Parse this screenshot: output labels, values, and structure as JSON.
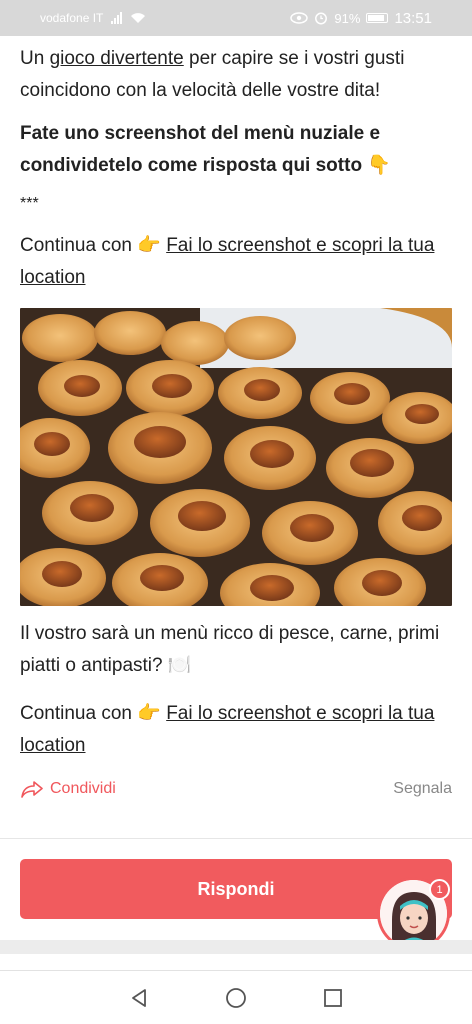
{
  "status": {
    "carrier": "vodafone IT",
    "battery": "91%",
    "time": "13:51"
  },
  "post": {
    "p1_a": "Un ",
    "p1_link": "gioco divertente",
    "p1_b": " per capire se i vostri gusti coincidono con la velocità delle vostre dita!",
    "p2": "Fate uno screenshot del menù nuziale e condividetelo come risposta qui sotto 👇",
    "stars": "***",
    "cont1_prefix": "Continua con 👉 ",
    "cont1_link": "Fai lo screenshot e scopri la tua location",
    "p3": "Il vostro sarà un menù ricco di pesce, carne, primi piatti o antipasti? 🍽️",
    "cont2_prefix": "Continua con 👉 ",
    "cont2_link": "Fai lo screenshot e scopri la tua location"
  },
  "actions": {
    "share": "Condividi",
    "report": "Segnala"
  },
  "reply": {
    "label": "Rispondi"
  },
  "notification": {
    "count": "1"
  },
  "colors": {
    "accent": "#f15b5e",
    "status_bar": "#d8d8d8"
  }
}
